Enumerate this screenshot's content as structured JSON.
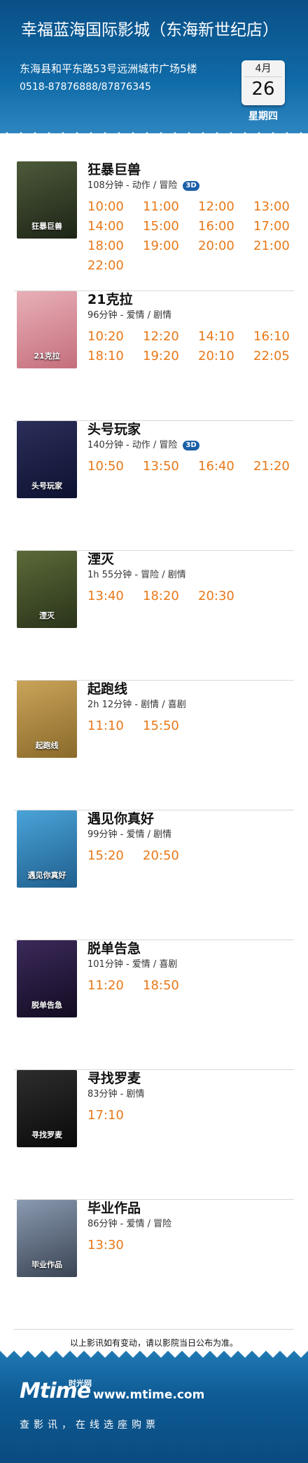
{
  "header": {
    "cinema": "幸福蓝海国际影城（东海新世纪店）",
    "address": "东海县和平东路53号远洲城市广场5楼",
    "phone": "0518-87876888/87876345",
    "date": {
      "month": "4月",
      "day": "26",
      "weekday": "星期四"
    }
  },
  "movies": [
    {
      "name": "狂暴巨兽",
      "meta": "108分钟 - 动作 / 冒险",
      "badge": "3D",
      "poster_title": "狂暴巨兽",
      "times": [
        "10:00",
        "11:00",
        "12:00",
        "13:00",
        "14:00",
        "15:00",
        "16:00",
        "17:00",
        "18:00",
        "19:00",
        "20:00",
        "21:00",
        "22:00"
      ]
    },
    {
      "name": "21克拉",
      "meta": "96分钟 - 爱情 / 剧情",
      "badge": "",
      "poster_title": "21克拉",
      "times": [
        "10:20",
        "12:20",
        "14:10",
        "16:10",
        "18:10",
        "19:20",
        "20:10",
        "22:05"
      ]
    },
    {
      "name": "头号玩家",
      "meta": "140分钟 - 动作 / 冒险",
      "badge": "3D",
      "poster_title": "头号玩家",
      "times": [
        "10:50",
        "13:50",
        "16:40",
        "21:20"
      ]
    },
    {
      "name": "湮灭",
      "meta": "1h 55分钟 - 冒险 / 剧情",
      "badge": "",
      "poster_title": "湮灭",
      "times": [
        "13:40",
        "18:20",
        "20:30"
      ]
    },
    {
      "name": "起跑线",
      "meta": "2h 12分钟 - 剧情 / 喜剧",
      "badge": "",
      "poster_title": "起跑线",
      "times": [
        "11:10",
        "15:50"
      ]
    },
    {
      "name": "遇见你真好",
      "meta": "99分钟 - 爱情 / 剧情",
      "badge": "",
      "poster_title": "遇见你真好",
      "times": [
        "15:20",
        "20:50"
      ]
    },
    {
      "name": "脱单告急",
      "meta": "101分钟 - 爱情 / 喜剧",
      "badge": "",
      "poster_title": "脱单告急",
      "times": [
        "11:20",
        "18:50"
      ]
    },
    {
      "name": "寻找罗麦",
      "meta": "83分钟 - 剧情",
      "badge": "",
      "poster_title": "寻找罗麦",
      "times": [
        "17:10"
      ]
    },
    {
      "name": "毕业作品",
      "meta": "86分钟 - 爱情 / 冒险",
      "badge": "",
      "poster_title": "毕业作品",
      "times": [
        "13:30"
      ]
    }
  ],
  "note": "以上影讯如有变动，请以影院当日公布为准。",
  "footer": {
    "logo": "Mtime",
    "logo_cn": "时光网",
    "site": "www.mtime.com",
    "slogan": "查影讯，在线选座购票"
  },
  "colors": {
    "header_blue": "#0f6aa7",
    "time_orange": "#e8791a",
    "badge_blue": "#1c5fa8"
  }
}
